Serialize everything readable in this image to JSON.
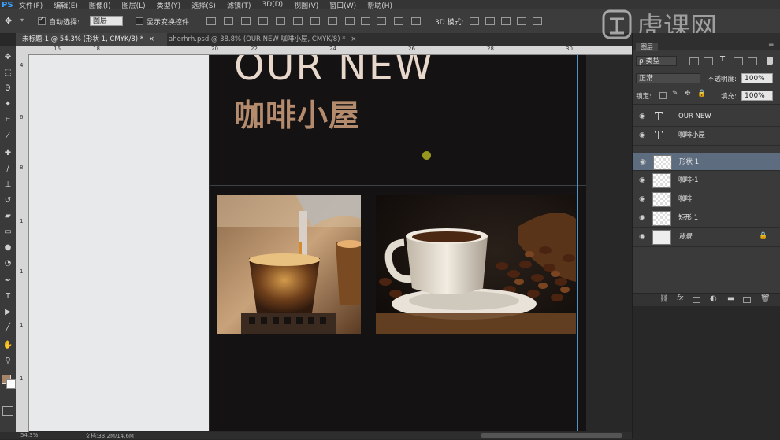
{
  "menu": {
    "logo": "PS",
    "items": [
      "文件(F)",
      "编辑(E)",
      "图像(I)",
      "图层(L)",
      "类型(Y)",
      "选择(S)",
      "滤镜(T)",
      "3D(D)",
      "视图(V)",
      "窗口(W)",
      "帮助(H)"
    ]
  },
  "options": {
    "auto_select_label": "自动选择:",
    "auto_select_value": "图层",
    "show_transform_label": "显示变换控件",
    "mode_3d_label": "3D 模式:"
  },
  "tabs": [
    {
      "label": "未标题-1 @ 54.3% (形状 1, CMYK/8) *",
      "close": "×"
    },
    {
      "label": "aherhrh.psd @ 38.8% (OUR NEW  咖啡小屋, CMYK/8) *",
      "close": "×"
    }
  ],
  "ruler": {
    "h_ticks": [
      "16",
      "18",
      "20",
      "22",
      "24",
      "26",
      "28",
      "30"
    ],
    "v_ticks": [
      "4",
      "6",
      "8",
      "1",
      "1",
      "1",
      "1"
    ]
  },
  "canvas": {
    "title_en": "OUR NEW",
    "title_cn": "咖啡小屋",
    "colors": {
      "page": "#141212",
      "title_en": "#e8d8cc",
      "title_cn": "#b58b6e",
      "dot": "#97961f",
      "guide": "#4d93c6"
    }
  },
  "status": {
    "zoom": "54.3%",
    "doc": "文档:33.2M/14.6M"
  },
  "layers_panel": {
    "tab_label": "图层",
    "filter_value": "ρ 类型",
    "blend_mode": "正常",
    "opacity_label": "不透明度:",
    "opacity_value": "100%",
    "lock_label": "锁定:",
    "fill_label": "填充:",
    "fill_value": "100%",
    "layers": [
      {
        "name": "OUR NEW",
        "kind": "text",
        "selected": false
      },
      {
        "name": "咖啡小屋",
        "kind": "text",
        "selected": false
      },
      {
        "name": "形状 1",
        "kind": "shape",
        "selected": true
      },
      {
        "name": "咖啡-1",
        "kind": "image",
        "selected": false
      },
      {
        "name": "咖啡",
        "kind": "image",
        "selected": false
      },
      {
        "name": "矩形 1",
        "kind": "shape",
        "selected": false
      },
      {
        "name": "背景",
        "kind": "background",
        "selected": false
      }
    ]
  },
  "watermark": {
    "text": "虎课网"
  }
}
